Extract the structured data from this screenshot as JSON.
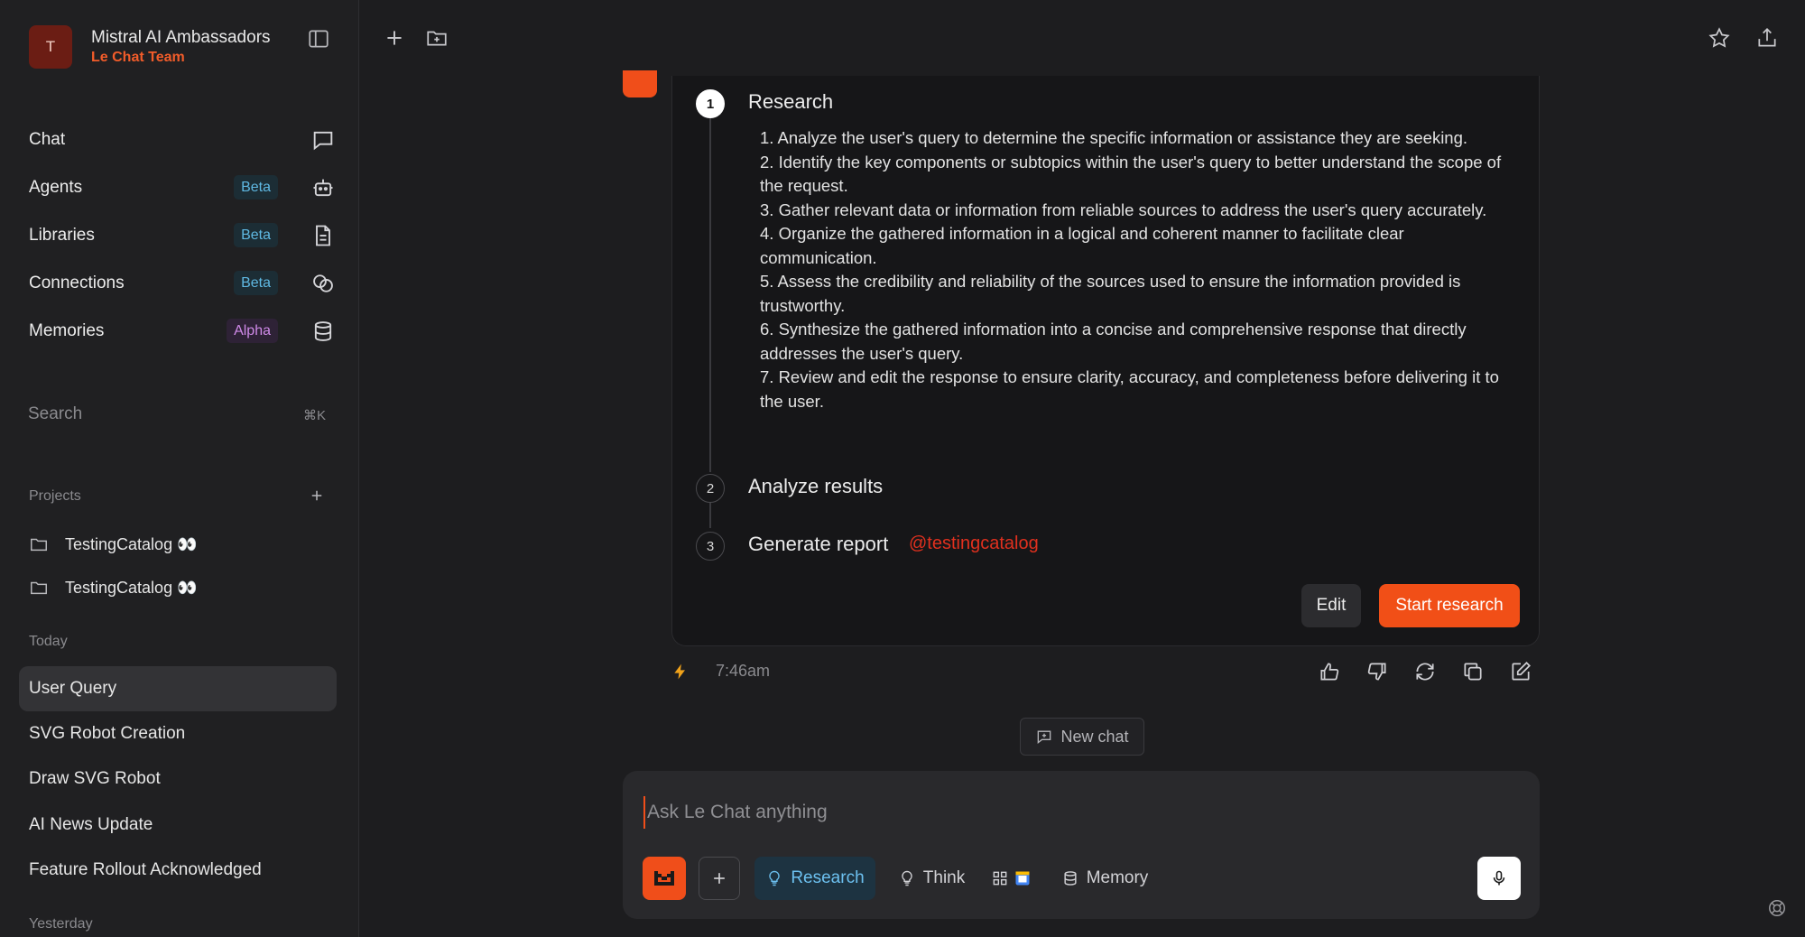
{
  "workspace": {
    "avatar_letter": "T",
    "name": "Mistral AI Ambassadors",
    "team": "Le Chat Team"
  },
  "nav": [
    {
      "label": "Chat",
      "badge": "",
      "icon": "chat-bubble-icon"
    },
    {
      "label": "Agents",
      "badge": "Beta",
      "icon": "robot-icon"
    },
    {
      "label": "Libraries",
      "badge": "Beta",
      "icon": "document-icon"
    },
    {
      "label": "Connections",
      "badge": "Beta",
      "icon": "link-circles-icon"
    },
    {
      "label": "Memories",
      "badge": "Alpha",
      "icon": "database-icon"
    }
  ],
  "search": {
    "label": "Search",
    "shortcut": "⌘K"
  },
  "projects": {
    "label": "Projects",
    "items": [
      {
        "name": "TestingCatalog 👀"
      },
      {
        "name": "TestingCatalog 👀"
      }
    ]
  },
  "history": {
    "today_label": "Today",
    "today": [
      {
        "title": "User Query",
        "active": true
      },
      {
        "title": "SVG Robot Creation"
      },
      {
        "title": "Draw SVG Robot"
      },
      {
        "title": "AI News Update"
      },
      {
        "title": "Feature Rollout Acknowledged"
      }
    ],
    "yesterday_label": "Yesterday"
  },
  "plan": {
    "steps": [
      {
        "number": "1",
        "title": "Research"
      },
      {
        "number": "2",
        "title": "Analyze results"
      },
      {
        "number": "3",
        "title": "Generate report"
      }
    ],
    "research_items": [
      "1. Analyze the user's query to determine the specific information or assistance they are seeking.",
      "2. Identify the key components or subtopics within the user's query to better understand the scope of the request.",
      "3. Gather relevant data or information from reliable sources to address the user's query accurately.",
      "4. Organize the gathered information in a logical and coherent manner to facilitate clear communication.",
      "5. Assess the credibility and reliability of the sources used to ensure the information provided is trustworthy.",
      "6. Synthesize the gathered information into a concise and comprehensive response that directly addresses the user's query.",
      "7. Review and edit the response to ensure clarity, accuracy, and completeness before delivering it to the user."
    ],
    "mention": "@testingcatalog",
    "edit_label": "Edit",
    "start_label": "Start research"
  },
  "message": {
    "timestamp": "7:46am"
  },
  "new_chat_label": "New chat",
  "composer": {
    "placeholder": "Ask Le Chat anything",
    "research_label": "Research",
    "think_label": "Think",
    "memory_label": "Memory"
  },
  "colors": {
    "accent": "#f04e1a",
    "research_blue": "#6cc0ef",
    "beta_badge": "#5fb8e2",
    "alpha_badge": "#cf8ae8"
  }
}
